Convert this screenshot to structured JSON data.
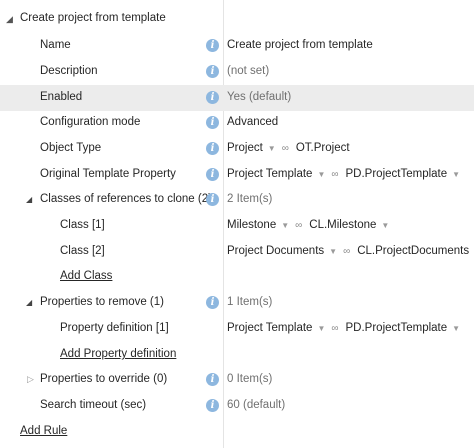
{
  "header": {
    "title": "Create project from template"
  },
  "rows": {
    "name": {
      "label": "Name",
      "value": "Create project from template"
    },
    "description": {
      "label": "Description",
      "value": "(not set)"
    },
    "enabled": {
      "label": "Enabled",
      "value": "Yes (default)"
    },
    "configuration_mode": {
      "label": "Configuration mode",
      "value": "Advanced"
    },
    "object_type": {
      "label": "Object Type",
      "value": "Project",
      "ref": "OT.Project"
    },
    "original_template_property": {
      "label": "Original Template Property",
      "value": "Project Template",
      "ref": "PD.ProjectTemplate"
    },
    "classes_to_clone": {
      "label": "Classes of references to clone (2)",
      "value": "2 Item(s)"
    },
    "class_1": {
      "label": "Class [1]",
      "value": "Milestone",
      "ref": "CL.Milestone"
    },
    "class_2": {
      "label": "Class [2]",
      "value": "Project Documents",
      "ref": "CL.ProjectDocuments"
    },
    "add_class": {
      "label": "Add Class"
    },
    "properties_to_remove": {
      "label": "Properties to remove (1)",
      "value": "1 Item(s)"
    },
    "property_definition_1": {
      "label": "Property definition [1]",
      "value": "Project Template",
      "ref": "PD.ProjectTemplate"
    },
    "add_property_definition": {
      "label": "Add Property definition"
    },
    "properties_to_override": {
      "label": "Properties to override (0)",
      "value": "0 Item(s)"
    },
    "search_timeout": {
      "label": "Search timeout (sec)",
      "value": "60 (default)"
    }
  },
  "footer": {
    "add_rule": "Add Rule"
  },
  "icons": {
    "info": "info-icon",
    "link": "link-icon",
    "dropdown": "chevron-down-icon",
    "expand": "triangle-expand-icon"
  },
  "colors": {
    "info_icon": "#8db7df",
    "highlight_row": "#ececec"
  }
}
